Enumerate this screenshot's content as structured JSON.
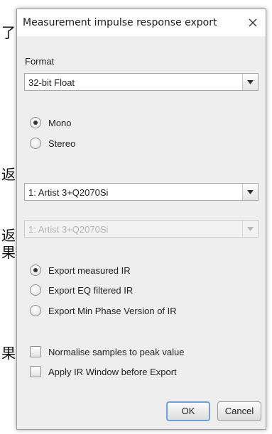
{
  "background": {
    "glyphs": [
      "了",
      "返",
      "返",
      "果",
      "果"
    ]
  },
  "dialog": {
    "title": "Measurement impulse response export",
    "close_icon": "close-icon"
  },
  "format": {
    "label": "Format",
    "selected": "32-bit Float"
  },
  "channels": {
    "options": [
      {
        "label": "Mono",
        "checked": true
      },
      {
        "label": "Stereo",
        "checked": false
      }
    ]
  },
  "measurement_primary": {
    "selected": "1: Artist 3+Q2070Si"
  },
  "measurement_secondary": {
    "selected": "1: Artist 3+Q2070Si",
    "enabled": false
  },
  "export_type": {
    "options": [
      {
        "label": "Export measured IR",
        "checked": true
      },
      {
        "label": "Export EQ filtered IR",
        "checked": false
      },
      {
        "label": "Export Min Phase Version of IR",
        "checked": false
      }
    ]
  },
  "checkboxes": [
    {
      "label": "Normalise samples to peak value",
      "checked": false
    },
    {
      "label": "Apply IR Window before Export",
      "checked": false
    }
  ],
  "buttons": {
    "ok_label": "OK",
    "cancel_label": "Cancel"
  },
  "colors": {
    "dialog_bg": "#eeeeee",
    "default_button_border": "#6fa1d8",
    "disabled_text": "#b3b3b3"
  }
}
